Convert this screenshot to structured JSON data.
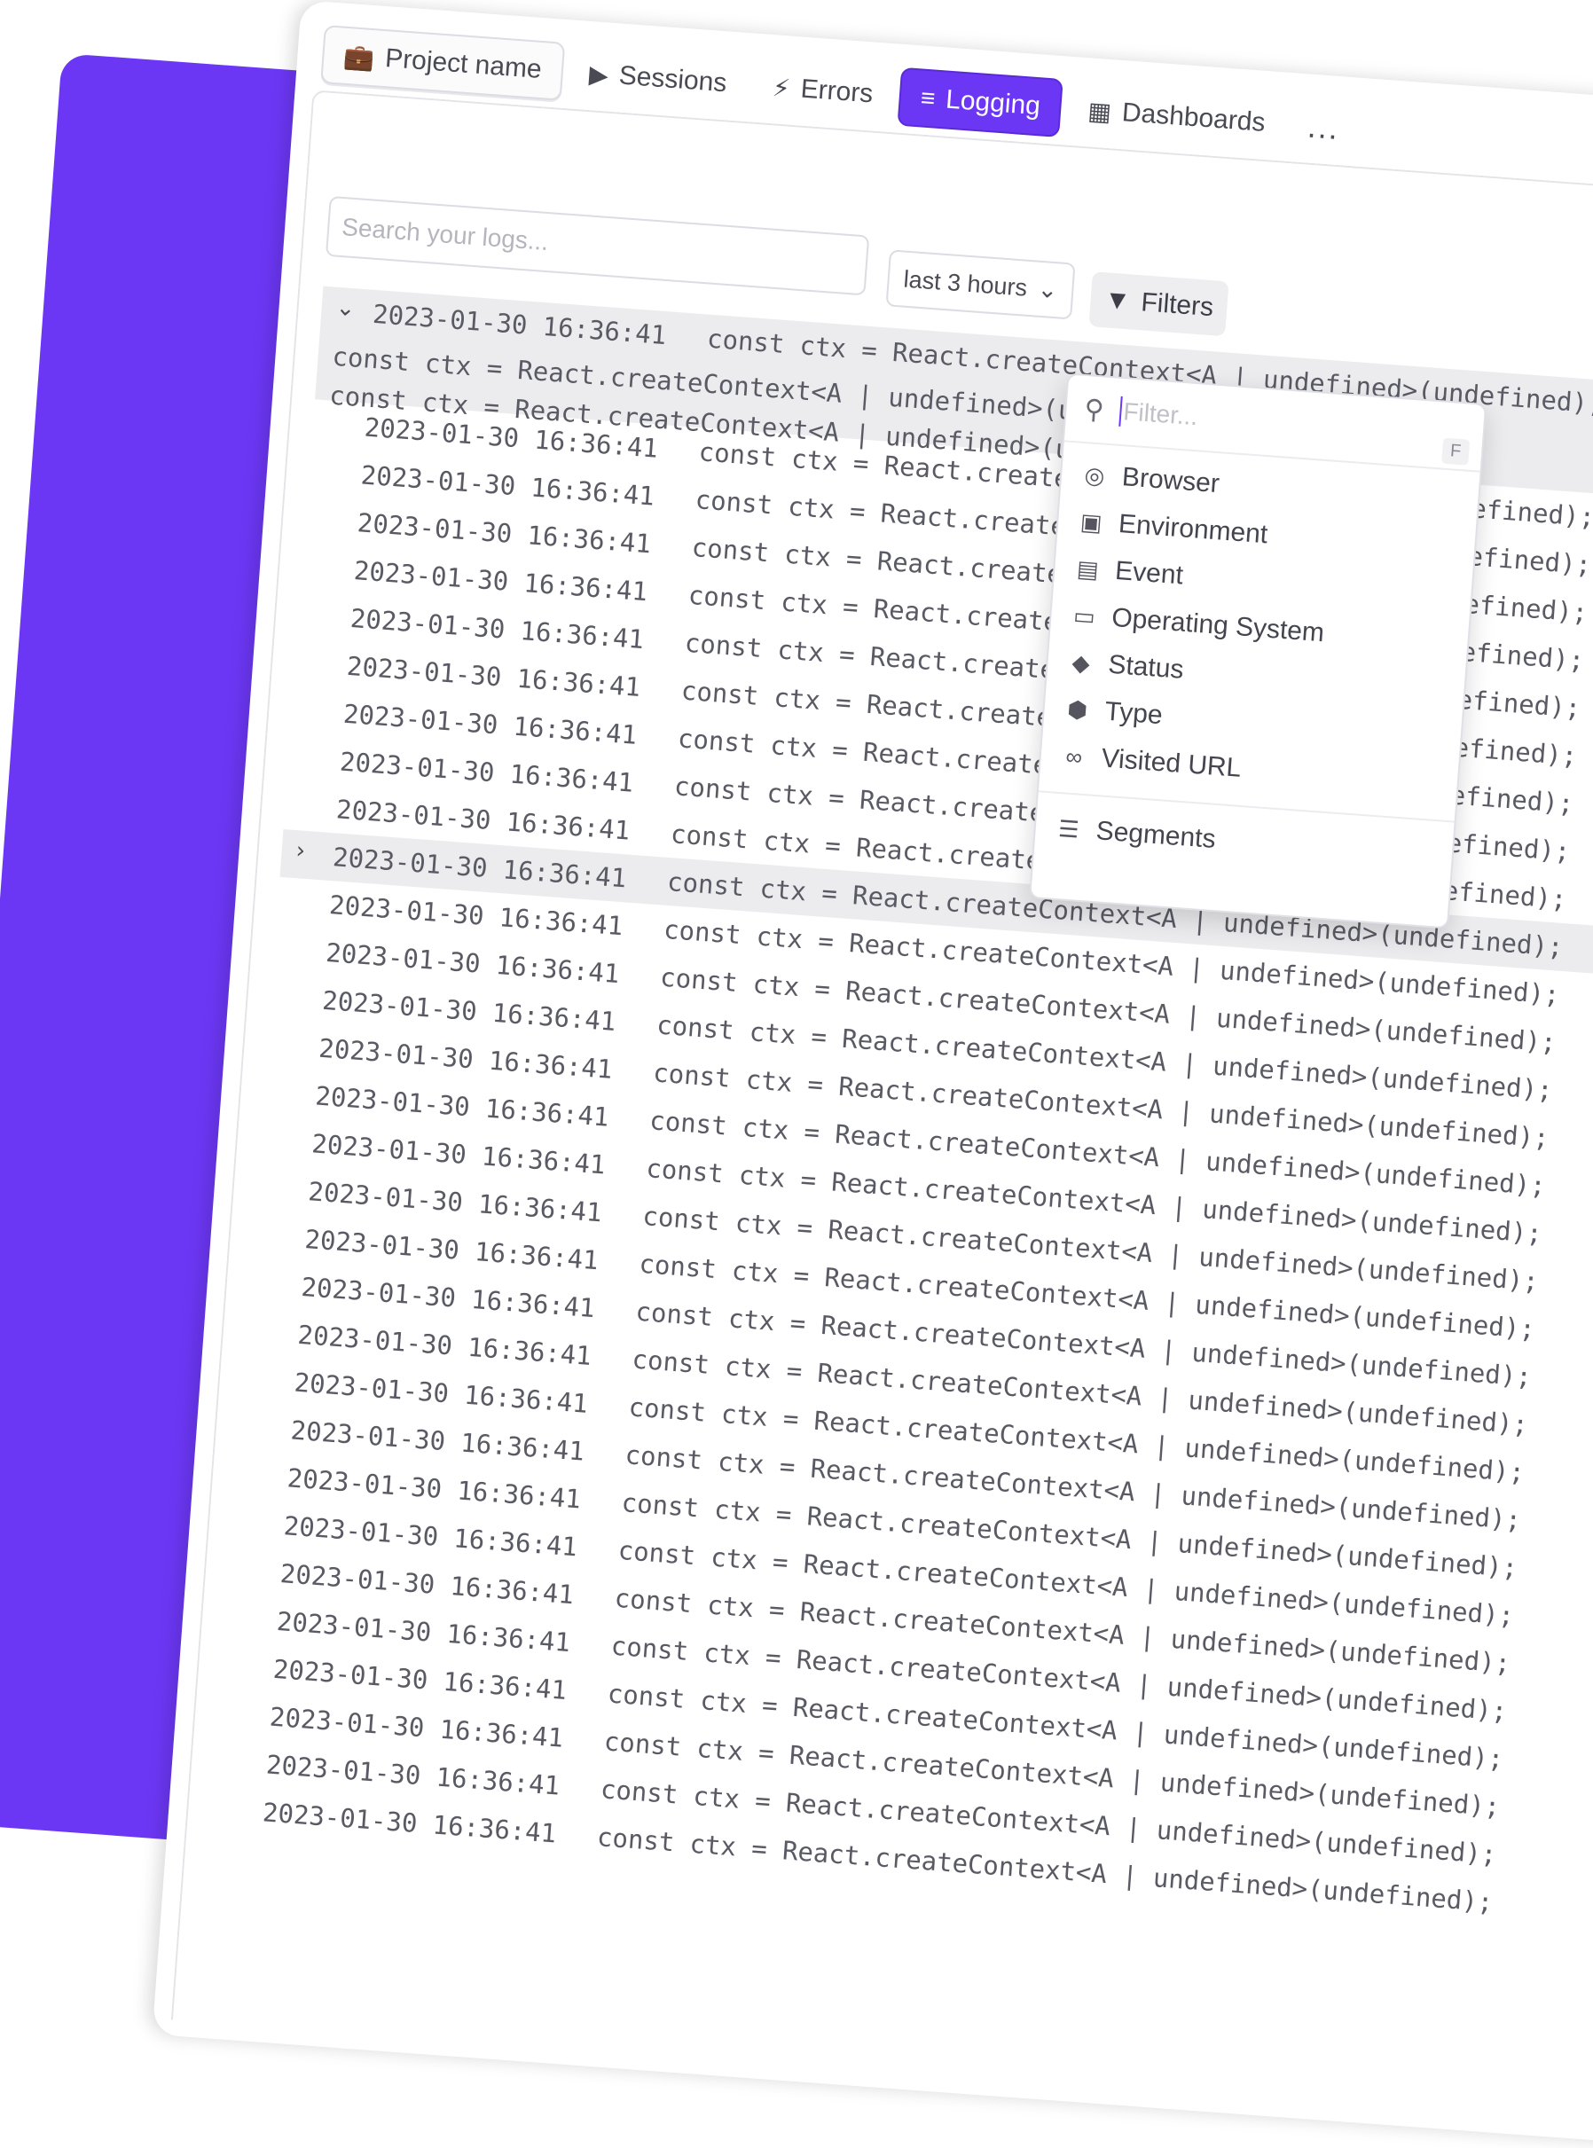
{
  "nav": {
    "project_label": "Project name",
    "items": [
      {
        "label": "Sessions",
        "icon": "play-circle-icon"
      },
      {
        "label": "Errors",
        "icon": "lightning-icon"
      },
      {
        "label": "Logging",
        "icon": "list-icon"
      },
      {
        "label": "Dashboards",
        "icon": "grid-icon"
      }
    ],
    "more": "..."
  },
  "search": {
    "placeholder": "Search your logs..."
  },
  "time_range": {
    "value": "last 3 hours"
  },
  "filters_button": {
    "label": "Filters"
  },
  "filter_dropdown": {
    "placeholder": "Filter...",
    "shortcut": "F",
    "items": [
      {
        "label": "Browser",
        "icon": "globe-icon"
      },
      {
        "label": "Environment",
        "icon": "terminal-icon"
      },
      {
        "label": "Event",
        "icon": "calendar-icon"
      },
      {
        "label": "Operating System",
        "icon": "monitor-icon"
      },
      {
        "label": "Status",
        "icon": "tag-icon"
      },
      {
        "label": "Type",
        "icon": "cube-icon"
      },
      {
        "label": "Visited URL",
        "icon": "link-icon"
      }
    ],
    "segments_label": "Segments"
  },
  "logs": {
    "timestamp": "2023-01-30 16:36:41",
    "message": "const ctx = React.createContext<A | undefined>(undefined);",
    "expanded_body": [
      "const ctx = React.createContext<A | undefined>(undefined);",
      "const ctx = React.createContext<A | undefined>(undefined);"
    ]
  }
}
